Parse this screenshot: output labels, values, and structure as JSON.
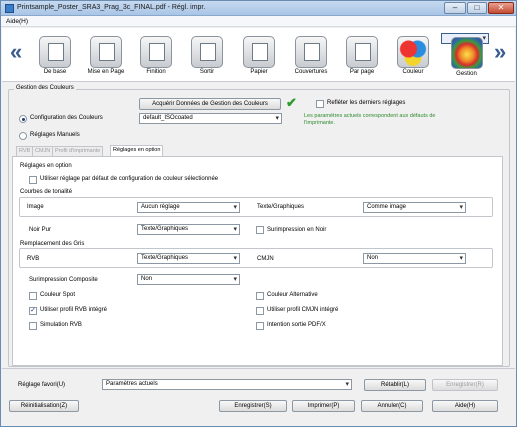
{
  "window": {
    "title": "Printsample_Poster_SRA3_Prag_3c_FINAL.pdf - Régl. impr.",
    "min": "–",
    "max": "□",
    "close": "✕"
  },
  "menu": {
    "help": "Aide(H)"
  },
  "toolbar": {
    "items": [
      "De base",
      "Mise en Page",
      "Finition",
      "Sortir",
      "Papier",
      "Couvertures",
      "Par page",
      "Couleur",
      "Gestion"
    ],
    "selected": "Gestion",
    "prev": "«",
    "next": "»"
  },
  "color_mgmt": {
    "group": "Gestion des Couleurs",
    "acquire": "Acquérir Données de Gestion des Couleurs",
    "check": "✔",
    "reflect": "Refléter les derniers réglages",
    "config_label": "Configuration des Couleurs",
    "config_value": "default_ISOcoated",
    "manual_label": "Réglages Manuels",
    "hint": "Les paramètres actuels correspondent aux défauts de l'imprimante."
  },
  "tabs": [
    "RVB",
    "CMJN",
    "Profil d'imprimante",
    "Réglages en option"
  ],
  "options": {
    "group": "Réglages en option",
    "use_default": "Utiliser réglage par défaut de configuration de couleur sélectionnée",
    "tone_group": "Courbes de tonalité",
    "image_label": "Image",
    "image_value": "Aucun réglage",
    "text_label": "Texte/Graphiques",
    "text_value": "Comme image",
    "black_label": "Noir Pur",
    "black_value": "Texte/Graphiques",
    "overprint_black": "Surimpression en Noir",
    "gray_group": "Remplacement des Gris",
    "rvb_label": "RVB",
    "rvb_value": "Texte/Graphiques",
    "cmjn_label": "CMJN",
    "cmjn_value": "Non",
    "composite_label": "Surimpression Composite",
    "composite_value": "Non",
    "spot": "Couleur Spot",
    "alt": "Couleur Alternative",
    "rvb_profile": "Utiliser profil RVB intégré",
    "cmjn_profile": "Utiliser profil CMJN intégré",
    "sim_rvb": "Simulation RVB",
    "pdfx": "Intention sortie PDF/X",
    "checkmark": "✓"
  },
  "favorites": {
    "label": "Réglage favori(U)",
    "value": "Paramètres actuels",
    "restore": "Rétablir(L)",
    "save": "Enregistrer(R)"
  },
  "footer": {
    "reset": "Réinitialisation(Z)",
    "save": "Enregistrer(S)",
    "print": "Imprimer(P)",
    "cancel": "Annuler(C)",
    "help": "Aide(H)"
  }
}
